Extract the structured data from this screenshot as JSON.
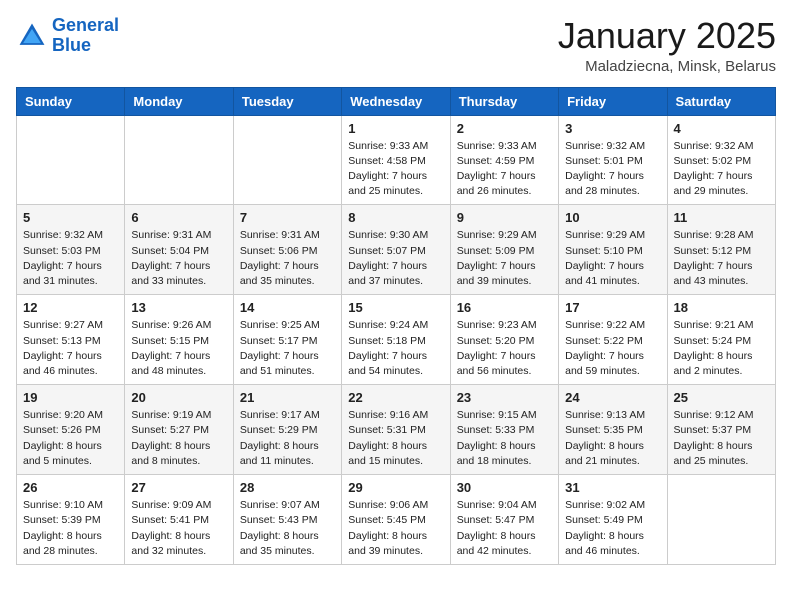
{
  "logo": {
    "line1": "General",
    "line2": "Blue"
  },
  "title": "January 2025",
  "location": "Maladziecna, Minsk, Belarus",
  "weekdays": [
    "Sunday",
    "Monday",
    "Tuesday",
    "Wednesday",
    "Thursday",
    "Friday",
    "Saturday"
  ],
  "weeks": [
    [
      {
        "day": "",
        "info": ""
      },
      {
        "day": "",
        "info": ""
      },
      {
        "day": "",
        "info": ""
      },
      {
        "day": "1",
        "info": "Sunrise: 9:33 AM\nSunset: 4:58 PM\nDaylight: 7 hours\nand 25 minutes."
      },
      {
        "day": "2",
        "info": "Sunrise: 9:33 AM\nSunset: 4:59 PM\nDaylight: 7 hours\nand 26 minutes."
      },
      {
        "day": "3",
        "info": "Sunrise: 9:32 AM\nSunset: 5:01 PM\nDaylight: 7 hours\nand 28 minutes."
      },
      {
        "day": "4",
        "info": "Sunrise: 9:32 AM\nSunset: 5:02 PM\nDaylight: 7 hours\nand 29 minutes."
      }
    ],
    [
      {
        "day": "5",
        "info": "Sunrise: 9:32 AM\nSunset: 5:03 PM\nDaylight: 7 hours\nand 31 minutes."
      },
      {
        "day": "6",
        "info": "Sunrise: 9:31 AM\nSunset: 5:04 PM\nDaylight: 7 hours\nand 33 minutes."
      },
      {
        "day": "7",
        "info": "Sunrise: 9:31 AM\nSunset: 5:06 PM\nDaylight: 7 hours\nand 35 minutes."
      },
      {
        "day": "8",
        "info": "Sunrise: 9:30 AM\nSunset: 5:07 PM\nDaylight: 7 hours\nand 37 minutes."
      },
      {
        "day": "9",
        "info": "Sunrise: 9:29 AM\nSunset: 5:09 PM\nDaylight: 7 hours\nand 39 minutes."
      },
      {
        "day": "10",
        "info": "Sunrise: 9:29 AM\nSunset: 5:10 PM\nDaylight: 7 hours\nand 41 minutes."
      },
      {
        "day": "11",
        "info": "Sunrise: 9:28 AM\nSunset: 5:12 PM\nDaylight: 7 hours\nand 43 minutes."
      }
    ],
    [
      {
        "day": "12",
        "info": "Sunrise: 9:27 AM\nSunset: 5:13 PM\nDaylight: 7 hours\nand 46 minutes."
      },
      {
        "day": "13",
        "info": "Sunrise: 9:26 AM\nSunset: 5:15 PM\nDaylight: 7 hours\nand 48 minutes."
      },
      {
        "day": "14",
        "info": "Sunrise: 9:25 AM\nSunset: 5:17 PM\nDaylight: 7 hours\nand 51 minutes."
      },
      {
        "day": "15",
        "info": "Sunrise: 9:24 AM\nSunset: 5:18 PM\nDaylight: 7 hours\nand 54 minutes."
      },
      {
        "day": "16",
        "info": "Sunrise: 9:23 AM\nSunset: 5:20 PM\nDaylight: 7 hours\nand 56 minutes."
      },
      {
        "day": "17",
        "info": "Sunrise: 9:22 AM\nSunset: 5:22 PM\nDaylight: 7 hours\nand 59 minutes."
      },
      {
        "day": "18",
        "info": "Sunrise: 9:21 AM\nSunset: 5:24 PM\nDaylight: 8 hours\nand 2 minutes."
      }
    ],
    [
      {
        "day": "19",
        "info": "Sunrise: 9:20 AM\nSunset: 5:26 PM\nDaylight: 8 hours\nand 5 minutes."
      },
      {
        "day": "20",
        "info": "Sunrise: 9:19 AM\nSunset: 5:27 PM\nDaylight: 8 hours\nand 8 minutes."
      },
      {
        "day": "21",
        "info": "Sunrise: 9:17 AM\nSunset: 5:29 PM\nDaylight: 8 hours\nand 11 minutes."
      },
      {
        "day": "22",
        "info": "Sunrise: 9:16 AM\nSunset: 5:31 PM\nDaylight: 8 hours\nand 15 minutes."
      },
      {
        "day": "23",
        "info": "Sunrise: 9:15 AM\nSunset: 5:33 PM\nDaylight: 8 hours\nand 18 minutes."
      },
      {
        "day": "24",
        "info": "Sunrise: 9:13 AM\nSunset: 5:35 PM\nDaylight: 8 hours\nand 21 minutes."
      },
      {
        "day": "25",
        "info": "Sunrise: 9:12 AM\nSunset: 5:37 PM\nDaylight: 8 hours\nand 25 minutes."
      }
    ],
    [
      {
        "day": "26",
        "info": "Sunrise: 9:10 AM\nSunset: 5:39 PM\nDaylight: 8 hours\nand 28 minutes."
      },
      {
        "day": "27",
        "info": "Sunrise: 9:09 AM\nSunset: 5:41 PM\nDaylight: 8 hours\nand 32 minutes."
      },
      {
        "day": "28",
        "info": "Sunrise: 9:07 AM\nSunset: 5:43 PM\nDaylight: 8 hours\nand 35 minutes."
      },
      {
        "day": "29",
        "info": "Sunrise: 9:06 AM\nSunset: 5:45 PM\nDaylight: 8 hours\nand 39 minutes."
      },
      {
        "day": "30",
        "info": "Sunrise: 9:04 AM\nSunset: 5:47 PM\nDaylight: 8 hours\nand 42 minutes."
      },
      {
        "day": "31",
        "info": "Sunrise: 9:02 AM\nSunset: 5:49 PM\nDaylight: 8 hours\nand 46 minutes."
      },
      {
        "day": "",
        "info": ""
      }
    ]
  ]
}
